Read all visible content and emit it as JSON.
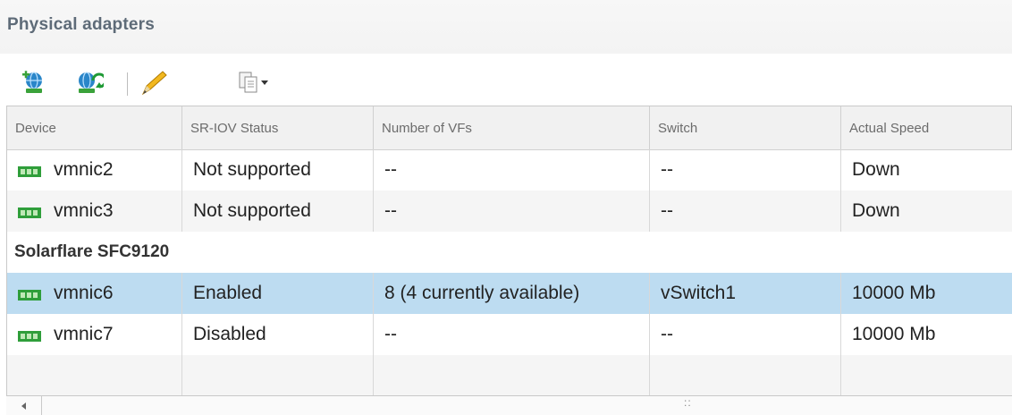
{
  "panel": {
    "title": "Physical adapters"
  },
  "toolbar": {
    "icons": [
      "add-networking-icon",
      "refresh-icon",
      "edit-icon",
      "copy-icon",
      "dropdown-arrow-icon"
    ]
  },
  "table": {
    "columns": [
      "Device",
      "SR-IOV Status",
      "Number of VFs",
      "Switch",
      "Actual Speed"
    ],
    "rows": [
      {
        "device": "vmnic2",
        "sriov": "Not supported",
        "vfs": "--",
        "switch": "--",
        "speed": "Down"
      },
      {
        "device": "vmnic3",
        "sriov": "Not supported",
        "vfs": "--",
        "switch": "--",
        "speed": "Down"
      },
      {
        "device": "vmnic6",
        "sriov": "Enabled",
        "vfs": "8 (4 currently available)",
        "switch": "vSwitch1",
        "speed": "10000 Mb"
      },
      {
        "device": "vmnic7",
        "sriov": "Disabled",
        "vfs": "--",
        "switch": "--",
        "speed": "10000 Mb"
      }
    ],
    "group_label": "Solarflare SFC9120"
  },
  "colors": {
    "selected_row": "#bddcf1",
    "title": "#5e6b78",
    "nic_green": "#2f9e3a"
  }
}
